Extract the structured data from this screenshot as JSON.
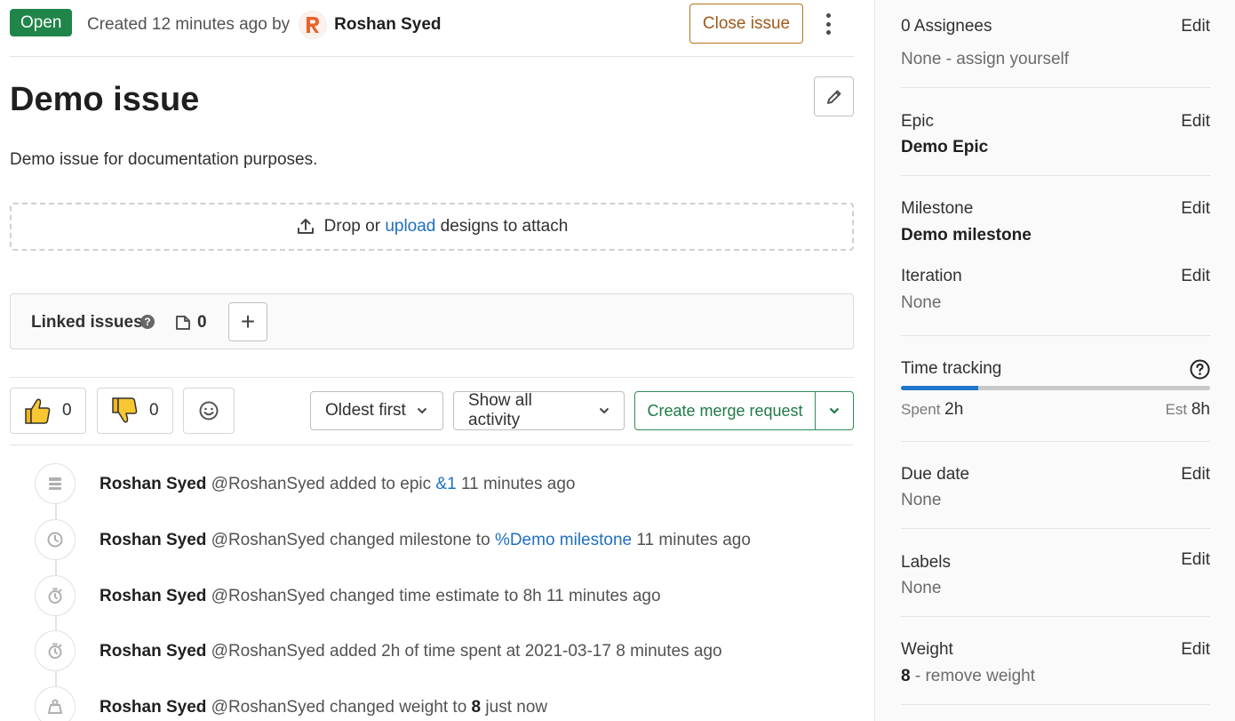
{
  "header": {
    "status": "Open",
    "created_text": "Created 12 minutes ago by",
    "author": "Roshan Syed",
    "avatar_letter": "R",
    "close_label": "Close issue"
  },
  "issue": {
    "title": "Demo issue",
    "description": "Demo issue for documentation purposes."
  },
  "designs": {
    "prefix": "Drop or",
    "link": "upload",
    "suffix": "designs to attach"
  },
  "linked_issues": {
    "label": "Linked issues",
    "count": "0"
  },
  "reactions": {
    "thumbs_up": "0",
    "thumbs_down": "0"
  },
  "controls": {
    "sort": "Oldest first",
    "filter": "Show all activity",
    "merge_request": "Create merge request"
  },
  "activity": [
    {
      "author": "Roshan Syed",
      "handle": "@RoshanSyed",
      "action": "added to epic",
      "link": "&1",
      "rest": "",
      "time": "11 minutes ago",
      "icon": "epic-icon"
    },
    {
      "author": "Roshan Syed",
      "handle": "@RoshanSyed",
      "action": "changed milestone to",
      "link": "%Demo milestone",
      "rest": "",
      "time": "11 minutes ago",
      "icon": "clock-icon"
    },
    {
      "author": "Roshan Syed",
      "handle": "@RoshanSyed",
      "action": "changed time estimate to 8h",
      "link": "",
      "rest": "",
      "time": "11 minutes ago",
      "icon": "timer-icon"
    },
    {
      "author": "Roshan Syed",
      "handle": "@RoshanSyed",
      "action": "added 2h of time spent at 2021-03-17",
      "link": "",
      "rest": "",
      "time": "8 minutes ago",
      "icon": "timer-icon"
    },
    {
      "author": "Roshan Syed",
      "handle": "@RoshanSyed",
      "action": "changed weight to",
      "link": "",
      "rest": "8",
      "time": "just now",
      "icon": "weight-icon"
    }
  ],
  "sidebar": {
    "edit_label": "Edit",
    "assignees": {
      "label": "0 Assignees",
      "value": "None - assign yourself"
    },
    "epic": {
      "label": "Epic",
      "value": "Demo Epic"
    },
    "milestone": {
      "label": "Milestone",
      "value": "Demo milestone"
    },
    "iteration": {
      "label": "Iteration",
      "value": "None"
    },
    "time_tracking": {
      "label": "Time tracking",
      "spent_label": "Spent",
      "spent": "2h",
      "est_label": "Est",
      "est": "8h",
      "progress_fraction": 0.25
    },
    "due_date": {
      "label": "Due date",
      "value": "None"
    },
    "labels": {
      "label": "Labels",
      "value": "None"
    },
    "weight": {
      "label": "Weight",
      "value": "8",
      "remove": "- remove weight"
    }
  }
}
